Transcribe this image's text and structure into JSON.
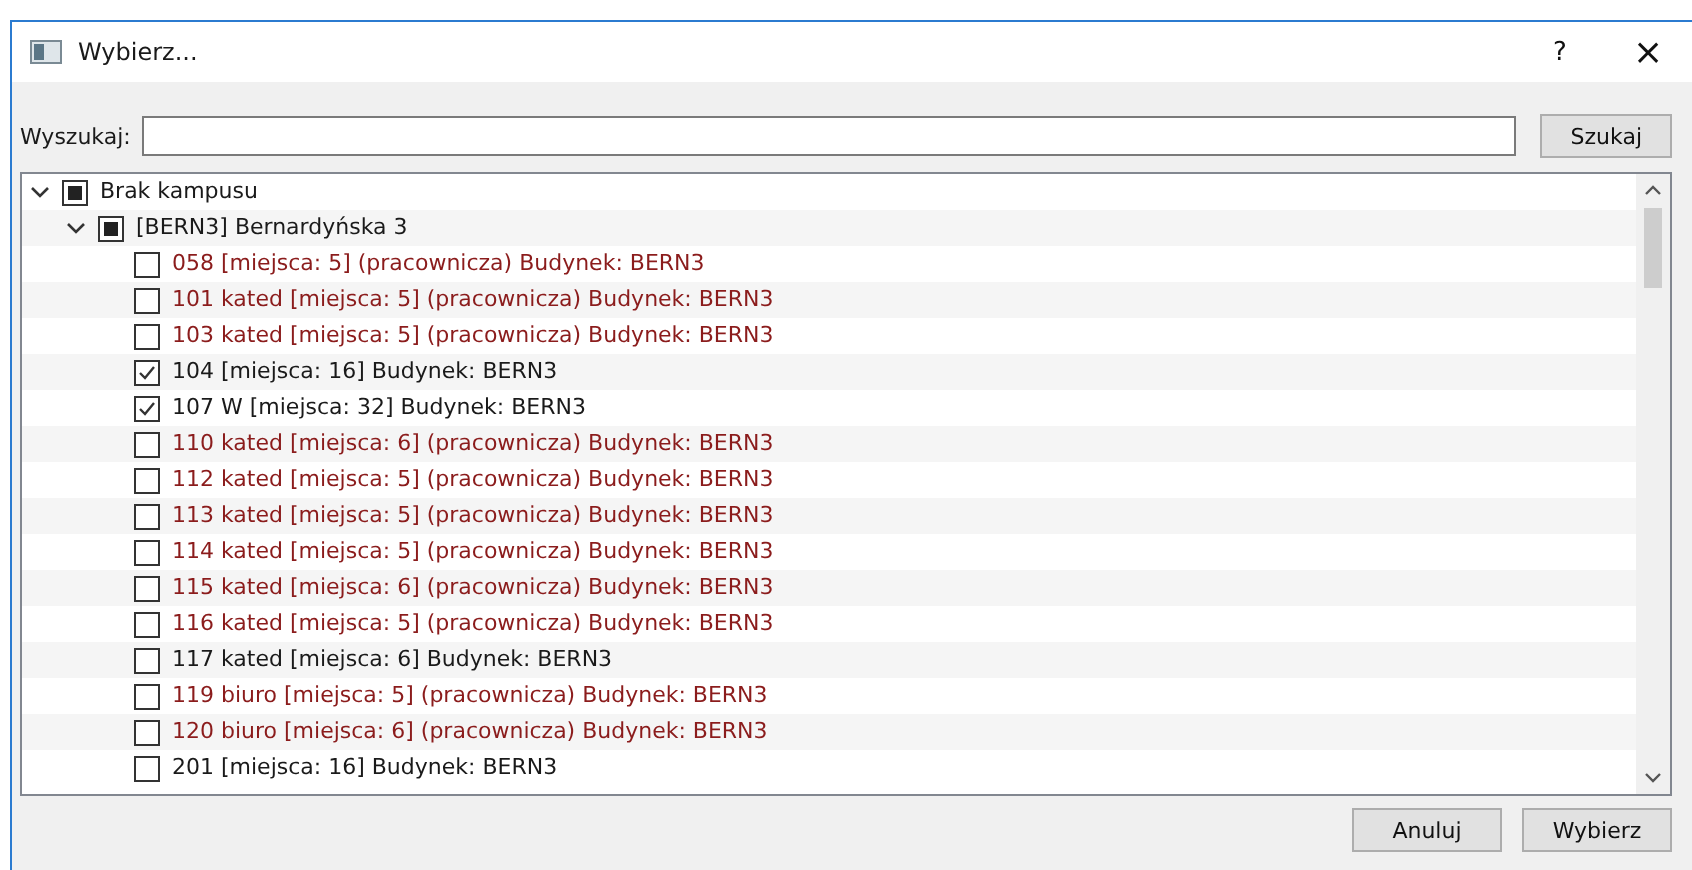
{
  "window": {
    "title": "Wybierz...",
    "help": "?",
    "close": "×"
  },
  "search": {
    "label": "Wyszukaj:",
    "button": "Szukaj"
  },
  "tree": [
    {
      "label": "Brak kampusu",
      "expanded": true,
      "checked": false,
      "partial": true,
      "children": [
        {
          "label": "[BERN3] Bernardyńska 3",
          "expanded": true,
          "checked": false,
          "partial": true,
          "children": [
            {
              "label": "058 [miejsca: 5] (pracownicza)  Budynek: BERN3",
              "checked": false,
              "color": "#8b1c1c"
            },
            {
              "label": "101 kated [miejsca: 5] (pracownicza)  Budynek: BERN3",
              "checked": false,
              "color": "#8b1c1c"
            },
            {
              "label": "103 kated [miejsca: 5] (pracownicza)  Budynek: BERN3",
              "checked": false,
              "color": "#8b1c1c"
            },
            {
              "label": "104 [miejsca: 16]  Budynek: BERN3",
              "checked": true,
              "color": "#1a1a1a"
            },
            {
              "label": "107 W [miejsca: 32]  Budynek: BERN3",
              "checked": true,
              "color": "#1a1a1a"
            },
            {
              "label": "110 kated [miejsca: 6] (pracownicza)  Budynek: BERN3",
              "checked": false,
              "color": "#8b1c1c"
            },
            {
              "label": "112 kated [miejsca: 5] (pracownicza)  Budynek: BERN3",
              "checked": false,
              "color": "#8b1c1c"
            },
            {
              "label": "113 kated [miejsca: 5] (pracownicza)  Budynek: BERN3",
              "checked": false,
              "color": "#8b1c1c"
            },
            {
              "label": "114 kated [miejsca: 5] (pracownicza)  Budynek: BERN3",
              "checked": false,
              "color": "#8b1c1c"
            },
            {
              "label": "115 kated [miejsca: 6] (pracownicza)  Budynek: BERN3",
              "checked": false,
              "color": "#8b1c1c"
            },
            {
              "label": "116 kated [miejsca: 5] (pracownicza)  Budynek: BERN3",
              "checked": false,
              "color": "#8b1c1c"
            },
            {
              "label": "117 kated [miejsca: 6]  Budynek: BERN3",
              "checked": false,
              "color": "#1a1a1a"
            },
            {
              "label": "119 biuro [miejsca: 5] (pracownicza)  Budynek: BERN3",
              "checked": false,
              "color": "#8b1c1c"
            },
            {
              "label": "120 biuro [miejsca: 6] (pracownicza)  Budynek: BERN3",
              "checked": false,
              "color": "#8b1c1c"
            },
            {
              "label": "201 [miejsca: 16]  Budynek: BERN3",
              "checked": false,
              "color": "#1a1a1a"
            }
          ]
        }
      ]
    }
  ],
  "buttons": [
    "Anuluj",
    "Wybierz"
  ]
}
